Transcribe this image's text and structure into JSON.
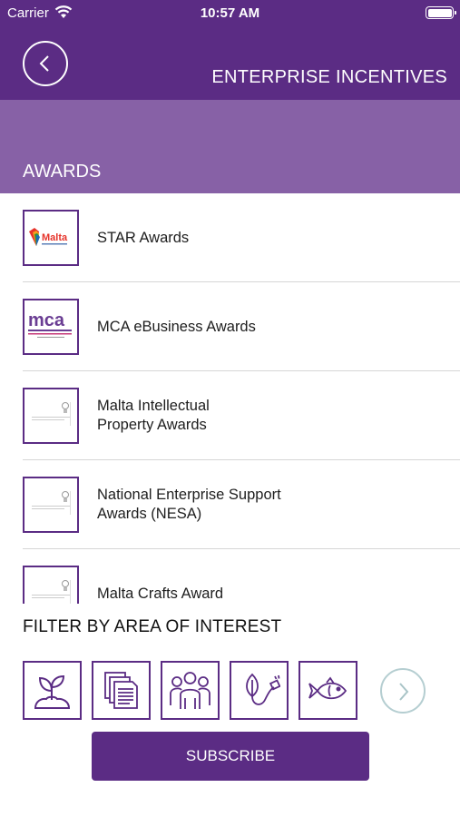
{
  "status_bar": {
    "carrier": "Carrier",
    "time": "10:57 AM"
  },
  "header": {
    "title": "ENTERPRISE INCENTIVES"
  },
  "section": {
    "title": "AWARDS"
  },
  "awards": [
    {
      "label": "STAR Awards",
      "logo": "malta-logo"
    },
    {
      "label": "MCA eBusiness Awards",
      "logo": "mca-logo"
    },
    {
      "label": "Malta Intellectual\nProperty Awards",
      "logo": "document-thumbnail"
    },
    {
      "label": "National Enterprise Support\nAwards (NESA)",
      "logo": "document-thumbnail"
    },
    {
      "label": "Malta Crafts Award",
      "logo": "document-thumbnail"
    }
  ],
  "logo_text": {
    "malta": "Malta",
    "mca": "mca"
  },
  "filter": {
    "title": "FILTER BY AREA OF INTEREST",
    "icons": [
      "plant-icon",
      "documents-icon",
      "people-icon",
      "eco-energy-icon",
      "fish-icon"
    ]
  },
  "subscribe": {
    "label": "SUBSCRIBE"
  },
  "colors": {
    "brand": "#5b2c84",
    "band": "#8761a6",
    "next_border": "#b5ced1"
  }
}
